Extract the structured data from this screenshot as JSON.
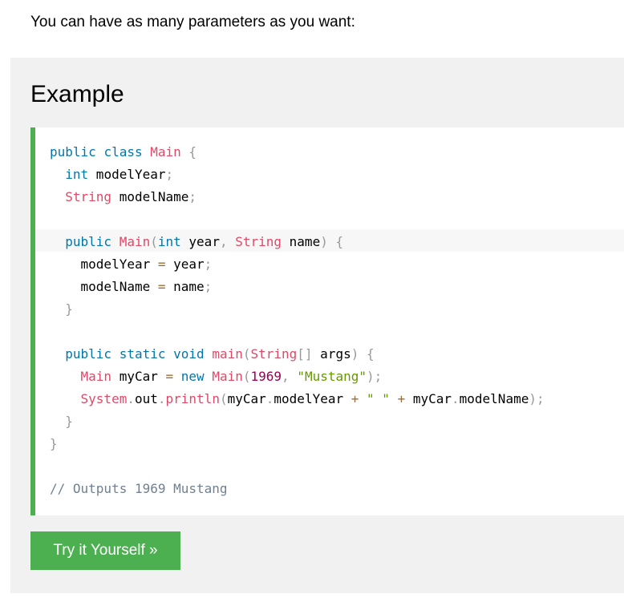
{
  "intro": {
    "text": "You can have as many parameters as you want:"
  },
  "example": {
    "heading": "Example",
    "accent_color": "#4caf50",
    "code_lines": [
      [
        {
          "t": "public",
          "c": "kw"
        },
        {
          "t": " ",
          "c": "pl"
        },
        {
          "t": "class",
          "c": "kw"
        },
        {
          "t": " ",
          "c": "pl"
        },
        {
          "t": "Main",
          "c": "ty"
        },
        {
          "t": " ",
          "c": "pl"
        },
        {
          "t": "{",
          "c": "pu"
        }
      ],
      [
        {
          "t": "  ",
          "c": "pl"
        },
        {
          "t": "int",
          "c": "kw"
        },
        {
          "t": " modelYear",
          "c": "pl"
        },
        {
          "t": ";",
          "c": "pu"
        }
      ],
      [
        {
          "t": "  ",
          "c": "pl"
        },
        {
          "t": "String",
          "c": "ty"
        },
        {
          "t": " modelName",
          "c": "pl"
        },
        {
          "t": ";",
          "c": "pu"
        }
      ],
      [],
      [
        {
          "t": "  ",
          "c": "pl"
        },
        {
          "t": "public",
          "c": "kw"
        },
        {
          "t": " ",
          "c": "pl"
        },
        {
          "t": "Main",
          "c": "ty"
        },
        {
          "t": "(",
          "c": "pu"
        },
        {
          "t": "int",
          "c": "kw"
        },
        {
          "t": " year",
          "c": "pl"
        },
        {
          "t": ",",
          "c": "pu"
        },
        {
          "t": " ",
          "c": "pl"
        },
        {
          "t": "String",
          "c": "ty"
        },
        {
          "t": " name",
          "c": "pl"
        },
        {
          "t": ")",
          "c": "pu"
        },
        {
          "t": " ",
          "c": "pl"
        },
        {
          "t": "{",
          "c": "pu"
        }
      ],
      [
        {
          "t": "    modelYear ",
          "c": "pl"
        },
        {
          "t": "=",
          "c": "op"
        },
        {
          "t": " year",
          "c": "pl"
        },
        {
          "t": ";",
          "c": "pu"
        }
      ],
      [
        {
          "t": "    modelName ",
          "c": "pl"
        },
        {
          "t": "=",
          "c": "op"
        },
        {
          "t": " name",
          "c": "pl"
        },
        {
          "t": ";",
          "c": "pu"
        }
      ],
      [
        {
          "t": "  ",
          "c": "pl"
        },
        {
          "t": "}",
          "c": "pu"
        }
      ],
      [],
      [
        {
          "t": "  ",
          "c": "pl"
        },
        {
          "t": "public",
          "c": "kw"
        },
        {
          "t": " ",
          "c": "pl"
        },
        {
          "t": "static",
          "c": "kw"
        },
        {
          "t": " ",
          "c": "pl"
        },
        {
          "t": "void",
          "c": "kw"
        },
        {
          "t": " ",
          "c": "pl"
        },
        {
          "t": "main",
          "c": "ty"
        },
        {
          "t": "(",
          "c": "pu"
        },
        {
          "t": "String",
          "c": "ty"
        },
        {
          "t": "[]",
          "c": "pu"
        },
        {
          "t": " args",
          "c": "pl"
        },
        {
          "t": ")",
          "c": "pu"
        },
        {
          "t": " ",
          "c": "pl"
        },
        {
          "t": "{",
          "c": "pu"
        }
      ],
      [
        {
          "t": "    ",
          "c": "pl"
        },
        {
          "t": "Main",
          "c": "ty"
        },
        {
          "t": " myCar ",
          "c": "pl"
        },
        {
          "t": "=",
          "c": "op"
        },
        {
          "t": " ",
          "c": "pl"
        },
        {
          "t": "new",
          "c": "kw"
        },
        {
          "t": " ",
          "c": "pl"
        },
        {
          "t": "Main",
          "c": "ty"
        },
        {
          "t": "(",
          "c": "pu"
        },
        {
          "t": "1969",
          "c": "nu"
        },
        {
          "t": ",",
          "c": "pu"
        },
        {
          "t": " ",
          "c": "pl"
        },
        {
          "t": "\"Mustang\"",
          "c": "st"
        },
        {
          "t": ")",
          "c": "pu"
        },
        {
          "t": ";",
          "c": "pu"
        }
      ],
      [
        {
          "t": "    ",
          "c": "pl"
        },
        {
          "t": "System",
          "c": "ty"
        },
        {
          "t": ".",
          "c": "pu"
        },
        {
          "t": "out",
          "c": "pl"
        },
        {
          "t": ".",
          "c": "pu"
        },
        {
          "t": "println",
          "c": "ty"
        },
        {
          "t": "(",
          "c": "pu"
        },
        {
          "t": "myCar",
          "c": "pl"
        },
        {
          "t": ".",
          "c": "pu"
        },
        {
          "t": "modelYear ",
          "c": "pl"
        },
        {
          "t": "+",
          "c": "op"
        },
        {
          "t": " ",
          "c": "pl"
        },
        {
          "t": "\" \"",
          "c": "st"
        },
        {
          "t": " ",
          "c": "pl"
        },
        {
          "t": "+",
          "c": "op"
        },
        {
          "t": " myCar",
          "c": "pl"
        },
        {
          "t": ".",
          "c": "pu"
        },
        {
          "t": "modelName",
          "c": "pl"
        },
        {
          "t": ")",
          "c": "pu"
        },
        {
          "t": ";",
          "c": "pu"
        }
      ],
      [
        {
          "t": "  ",
          "c": "pl"
        },
        {
          "t": "}",
          "c": "pu"
        }
      ],
      [
        {
          "t": "}",
          "c": "pu"
        }
      ],
      [],
      [
        {
          "t": "// Outputs 1969 Mustang",
          "c": "cm"
        }
      ]
    ],
    "try_button_label": "Try it Yourself »"
  }
}
